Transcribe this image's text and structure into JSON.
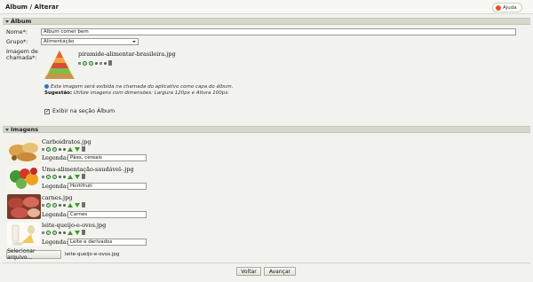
{
  "header": {
    "title": "Álbum / Alterar",
    "help_label": "Ajuda"
  },
  "album_section": {
    "title": "Álbum",
    "name_label": "Nome*:",
    "name_value": "Álbum comer bem",
    "group_label": "Grupo*:",
    "group_value": "Alimentação",
    "image_label_1": "Imagem de",
    "image_label_2": "chamada*:",
    "image_filename": "piramide-alimentar-brasileira.jpg",
    "info_line1": "Esta imagem será exibida na chamada do aplicativo como capa do álbum.",
    "info_hint_label": "Sugestão:",
    "info_hint_text": " Utilize imagens com dimensões: Largura 120px e Altura 100px.",
    "show_in_section_label": "Exibir na seção Álbum",
    "show_in_section_checked": true
  },
  "images_section": {
    "title": "Imagens",
    "caption_label": "Legenda:",
    "items": [
      {
        "filename": "Carboidratos.jpg",
        "caption": "Pães, cereais"
      },
      {
        "filename": "Uma-alimentação-saudável-.jpg",
        "caption": "Hortifruti"
      },
      {
        "filename": "carnes.jpg",
        "caption": "Carnes"
      },
      {
        "filename": "leite-queijo-e-ovos.jpg",
        "caption": "Leite e derivados"
      }
    ],
    "file_button_label": "Selecionar arquivo...",
    "selected_file": "leite-queijo-e-ovos.jpg"
  },
  "footer": {
    "back_label": "Voltar",
    "next_label": "Avançar"
  },
  "colors": {
    "section_bar": "#d6d6cd",
    "background": "#f2f2ee",
    "icon_green": "#3b9b2f"
  }
}
